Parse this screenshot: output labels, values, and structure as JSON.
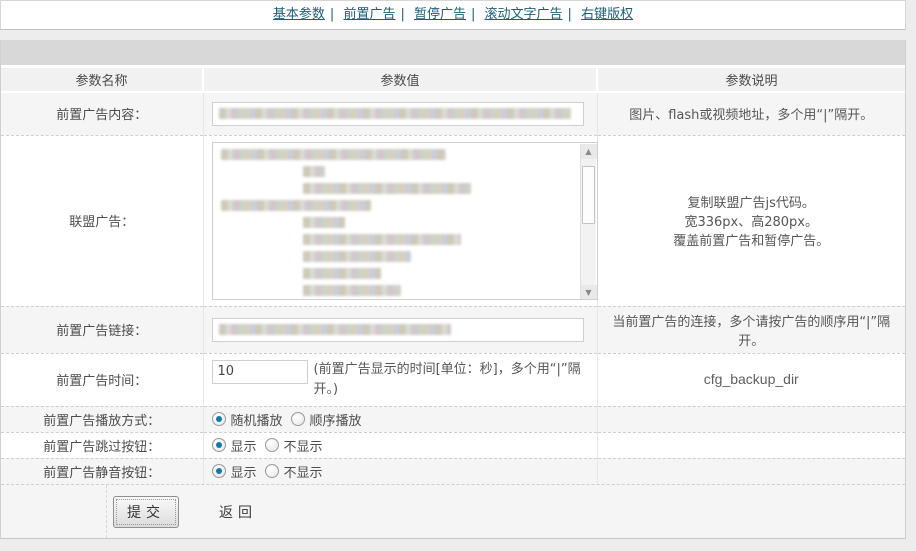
{
  "nav": {
    "separator": "|",
    "links": [
      {
        "label": "基本参数"
      },
      {
        "label": "前置广告"
      },
      {
        "label": "暂停广告"
      },
      {
        "label": "滚动文字广告"
      },
      {
        "label": "右键版权"
      }
    ]
  },
  "table": {
    "headers": {
      "name": "参数名称",
      "value": "参数值",
      "desc": "参数说明"
    },
    "rows": {
      "content": {
        "label": "前置广告内容：",
        "desc": "图片、flash或视频地址，多个用“|”隔开。"
      },
      "union": {
        "label": "联盟广告：",
        "desc1": "复制联盟广告js代码。",
        "desc2": "宽336px、高280px。",
        "desc3": "覆盖前置广告和暂停广告。"
      },
      "link": {
        "label": "前置广告链接：",
        "desc": "当前置广告的连接，多个请按广告的顺序用“|”隔开。"
      },
      "time": {
        "label": "前置广告时间：",
        "value": "10",
        "note": "(前置广告显示的时间[单位：秒]，多个用“|”隔开。)",
        "desc": "cfg_backup_dir"
      },
      "playmode": {
        "label": "前置广告播放方式：",
        "opt1": "随机播放",
        "opt2": "顺序播放"
      },
      "skip": {
        "label": "前置广告跳过按钮：",
        "opt1": "显示",
        "opt2": "不显示"
      },
      "mute": {
        "label": "前置广告静音按钮：",
        "opt1": "显示",
        "opt2": "不显示"
      }
    }
  },
  "footer": {
    "submit": "提交",
    "back": "返回"
  },
  "colors": {
    "link": "#1b5e78",
    "radio_selected": "#1677b0",
    "bar": "#d8d8d8"
  }
}
